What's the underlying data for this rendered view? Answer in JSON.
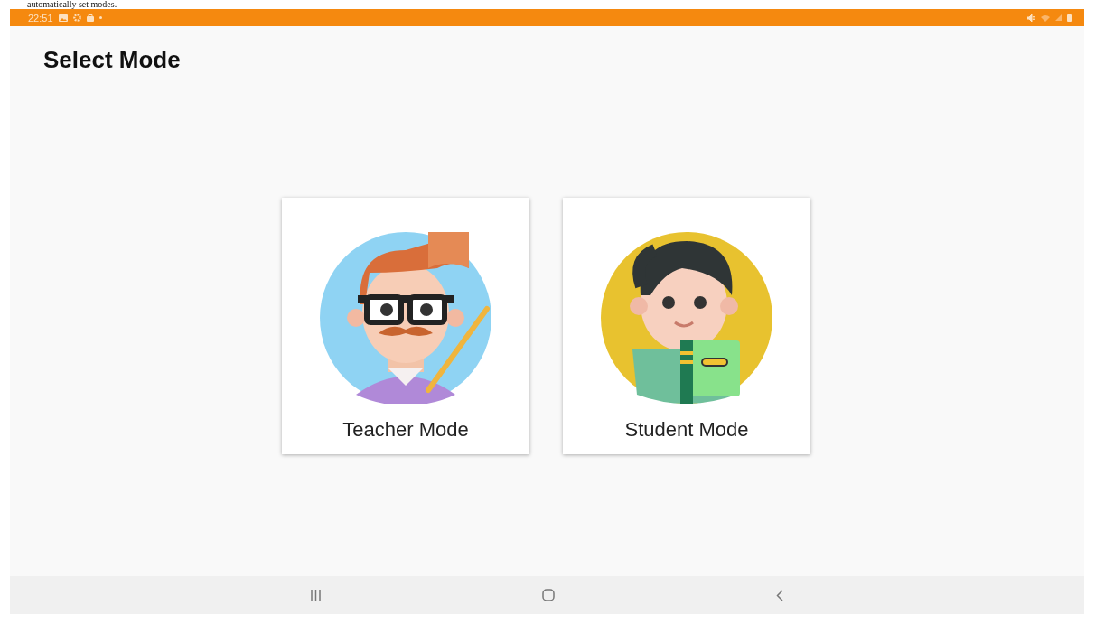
{
  "caption": "automatically set modes.",
  "status_bar": {
    "time": "22:51"
  },
  "title": "Select Mode",
  "modes": [
    {
      "label": "Teacher Mode",
      "kind": "teacher"
    },
    {
      "label": "Student Mode",
      "kind": "student"
    }
  ]
}
